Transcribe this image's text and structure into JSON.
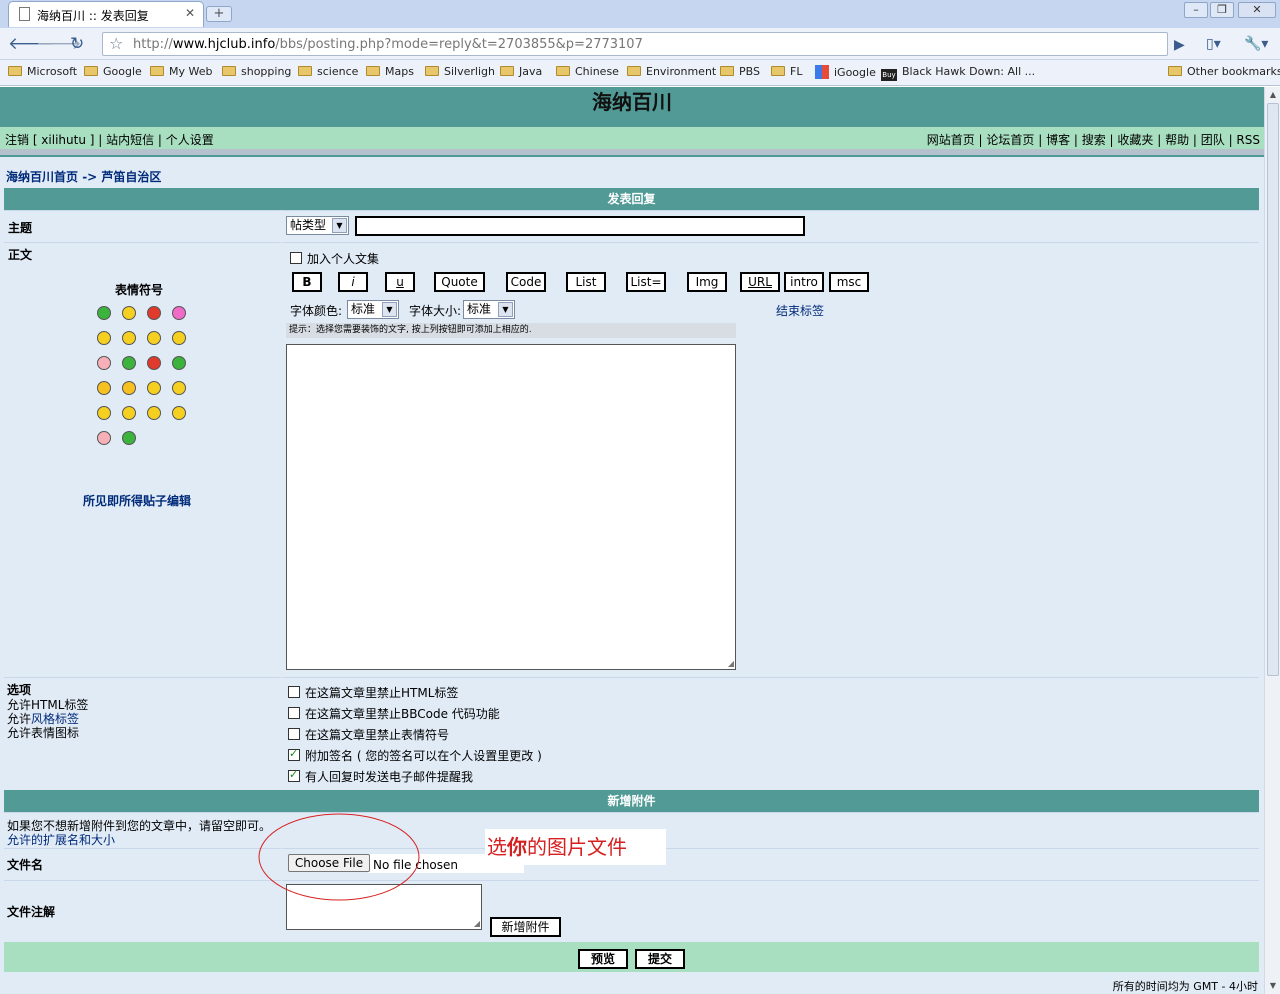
{
  "browser": {
    "tab_title": "海纳百川 :: 发表回复",
    "url_prefix": "http://",
    "url_host": "www.hjclub.info",
    "url_path": "/bbs/posting.php?mode=reply&t=2703855&p=2773107",
    "bookmarks": [
      "Microsoft",
      "Google",
      "My Web",
      "shopping",
      "science",
      "Maps",
      "Silverligh",
      "Java",
      "Chinese",
      "Environment",
      "PBS",
      "FL",
      "iGoogle",
      "Black Hawk Down: All ...",
      "Other bookmarks"
    ]
  },
  "site": {
    "title": "海纳百川",
    "nav_left": "注销 [ xilihutu ] | 站内短信 | 个人设置",
    "nav_right": "网站首页 | 论坛首页 | 博客 | 搜索 | 收藏夹 | 帮助 | 团队 | RSS",
    "breadcrumb_home": "海纳百川首页",
    "breadcrumb_arrow": " -> ",
    "breadcrumb_forum": "芦笛自治区"
  },
  "form": {
    "section_title": "发表回复",
    "subject_label": "主题",
    "post_type_value": "帖类型",
    "body_label": "正文",
    "add_collection_label": "加入个人文集",
    "format_buttons": [
      "B",
      "i",
      "u",
      "Quote",
      "Code",
      "List",
      "List=",
      "Img",
      "URL",
      "intro",
      "msc"
    ],
    "font_color_label": "字体颜色:",
    "font_color_value": "标准",
    "font_size_label": "字体大小:",
    "font_size_value": "标准",
    "close_tags": "结束标签",
    "hint": "提示：选择您需要装饰的文字, 按上列按钮即可添加上相应的.",
    "smilies_title": "表情符号",
    "wysiwyg_link": "所见即所得贴子编辑",
    "options_title": "选项",
    "options_left": [
      "允许HTML标签",
      "允许",
      "风格标签",
      "允许表情图标"
    ],
    "options": [
      {
        "label": "在这篇文章里禁止HTML标签",
        "checked": false
      },
      {
        "label": "在这篇文章里禁止BBCode 代码功能",
        "checked": false
      },
      {
        "label": "在这篇文章里禁止表情符号",
        "checked": false
      },
      {
        "label": "附加签名 ( 您的签名可以在个人设置里更改 )",
        "checked": true
      },
      {
        "label": "有人回复时发送电子邮件提醒我",
        "checked": true
      }
    ],
    "attach_title": "新增附件",
    "attach_note": "如果您不想新增附件到您的文章中，请留空即可。",
    "attach_ext_link": "允许的扩展名和大小",
    "filename_label": "文件名",
    "choose_file": "Choose File",
    "no_file": "No file chosen",
    "annotation_pre": "选",
    "annotation_bold": "你",
    "annotation_post": "的图片文件",
    "comment_label": "文件注解",
    "add_attach_button": "新增附件",
    "preview_button": "预览",
    "submit_button": "提交",
    "footer_time": "所有的时间均为 GMT - 4小时"
  },
  "colors": {
    "header": "#519a96",
    "nav": "#a9dfc1",
    "page_bg": "#e1ebf6",
    "annotation": "#d62020"
  },
  "smilies": [
    "grin",
    "smile",
    "sad",
    "surprised",
    "shocked",
    "confused",
    "cool",
    "laughing",
    "mad",
    "razz",
    "embarrassed",
    "crying",
    "evil",
    "twisted",
    "rolleyes",
    "wink",
    "exclaim",
    "question",
    "idea",
    "arrow",
    "neutral",
    "mrgreen"
  ]
}
